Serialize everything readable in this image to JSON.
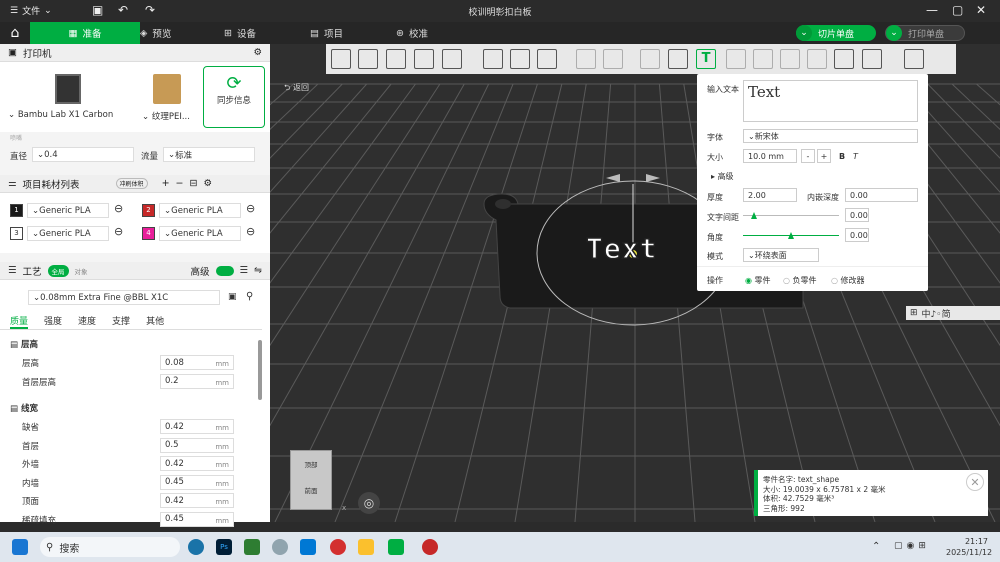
{
  "window": {
    "menu_label": "文件",
    "title": "校训明彰扣白板"
  },
  "tabs": {
    "prepare": "准备",
    "preview": "预览",
    "device": "设备",
    "project": "项目",
    "calibrate": "校准"
  },
  "actions": {
    "slice": "切片单盘",
    "print": "打印单盘"
  },
  "printer": {
    "header": "打印机",
    "model": "Bambu Lab X1 Carbon",
    "plate": "纹理PEI...",
    "sync": "同步信息",
    "nozzle_label": "直径",
    "nozzle_value": "0.4",
    "flow_label": "流量",
    "flow_value": "标准",
    "small": "喷嘴"
  },
  "filament": {
    "header": "项目耗材列表",
    "badge": "冲刷体积",
    "items": [
      {
        "n": "1",
        "name": "Generic PLA",
        "color": "#1a1a1a"
      },
      {
        "n": "2",
        "name": "Generic PLA",
        "color": "#c62828"
      },
      {
        "n": "3",
        "name": "Generic PLA",
        "color": "#ffffff"
      },
      {
        "n": "4",
        "name": "Generic PLA",
        "color": "#e91e9a"
      }
    ]
  },
  "process": {
    "header": "工艺",
    "global": "全局",
    "object": "对象",
    "advanced": "高级",
    "preset": "0.08mm Extra Fine @BBL X1C",
    "subtabs": [
      "质量",
      "强度",
      "速度",
      "支撑",
      "其他"
    ],
    "group1": "层高",
    "group2": "线宽",
    "unit": "mm",
    "rows1": [
      {
        "label": "层高",
        "value": "0.08"
      },
      {
        "label": "首层层高",
        "value": "0.2"
      }
    ],
    "rows2": [
      {
        "label": "缺省",
        "value": "0.42"
      },
      {
        "label": "首层",
        "value": "0.5"
      },
      {
        "label": "外墙",
        "value": "0.42"
      },
      {
        "label": "内墙",
        "value": "0.45"
      },
      {
        "label": "顶面",
        "value": "0.42"
      },
      {
        "label": "稀疏填充",
        "value": "0.45"
      }
    ]
  },
  "viewport": {
    "return": "返回",
    "text3d": "Text",
    "cube_top": "顶部",
    "cube_front": "前面",
    "axis_x": "x"
  },
  "textpanel": {
    "input_label": "输入文本",
    "input_value": "Text",
    "font_label": "字体",
    "font_value": "新宋体",
    "size_label": "大小",
    "size_value": "10.0 mm",
    "minus": "-",
    "plus": "+",
    "bold": "B",
    "italic": "T",
    "advanced": "高级",
    "thick_label": "厚度",
    "thick_value": "2.00",
    "embed_label": "内嵌深度",
    "embed_value": "0.00",
    "spacing_label": "文字间距",
    "spacing_value": "0.00",
    "angle_label": "角度",
    "angle_value": "0.00",
    "mode_label": "模式",
    "mode_value": "环绕表面",
    "op_label": "操作",
    "op1": "零件",
    "op2": "负零件",
    "op3": "修改器"
  },
  "ime": "中♪◦简",
  "info": {
    "l1": "零件名字:  text_shape",
    "l2": "大小:   19.0039 x 6.75781 x 2 毫米",
    "l3": "体积:   42.7529 毫米³",
    "l4": "三角形:   992"
  },
  "taskbar": {
    "search": "搜索",
    "time": "21:17",
    "date": "2025/11/12"
  }
}
